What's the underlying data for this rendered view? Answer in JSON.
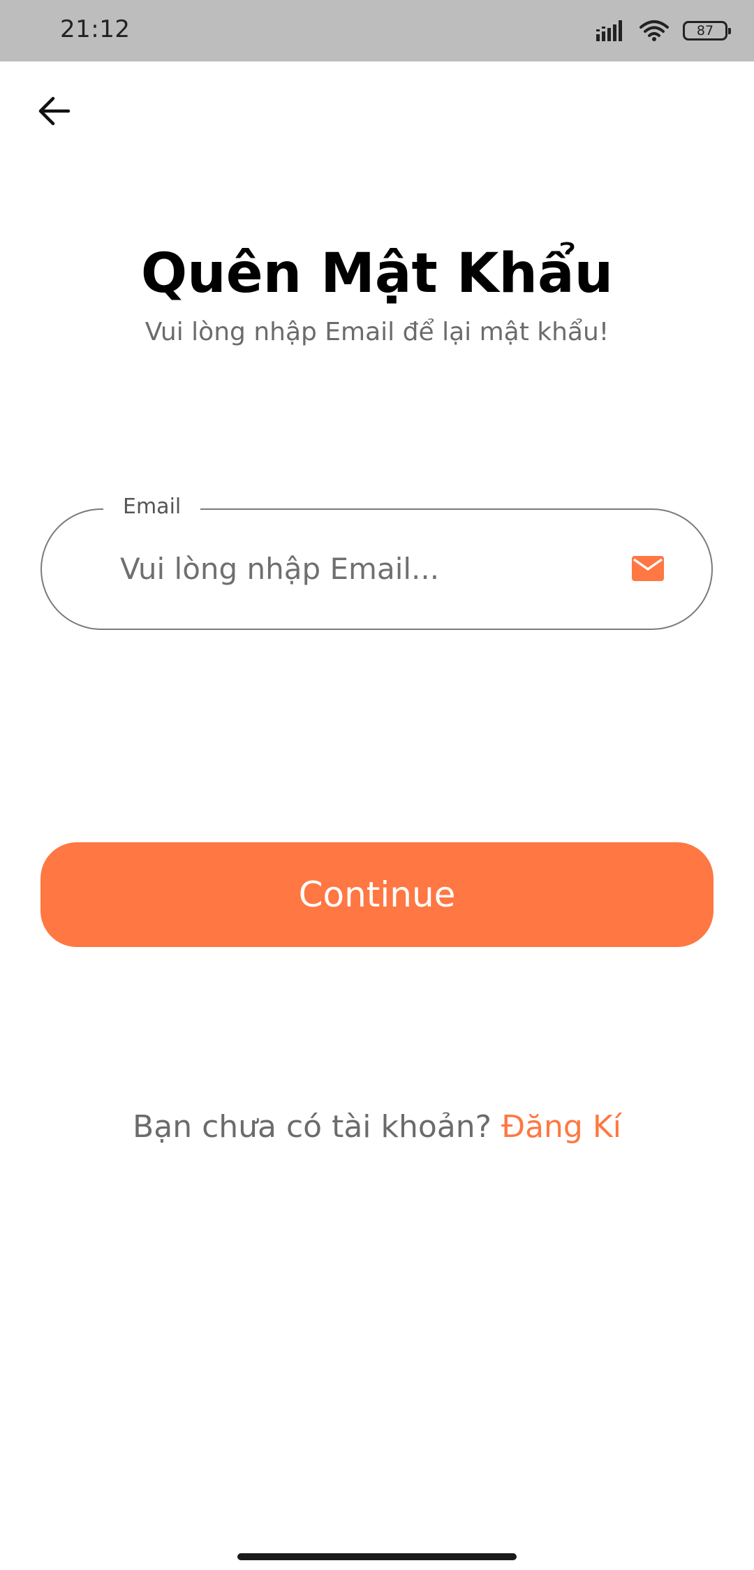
{
  "status_bar": {
    "time": "21:12",
    "battery_level": "87",
    "icons": [
      "signal-icon",
      "wifi-icon",
      "battery-icon"
    ]
  },
  "header": {
    "back_icon": "arrow-left-icon"
  },
  "page": {
    "title": "Quên Mật Khẩu",
    "subtitle": "Vui lòng nhập Email để lại mật khẩu!"
  },
  "email_field": {
    "label": "Email",
    "placeholder": "Vui lòng nhập Email...",
    "value": "",
    "icon": "mail-icon"
  },
  "continue_button": {
    "label": "Continue"
  },
  "register": {
    "prompt": "Bạn chưa có tài khoản? ",
    "link_label": "Đăng Kí"
  },
  "colors": {
    "accent": "#ff7742",
    "status_bar_bg": "#bdbdbd",
    "text_secondary": "#6b6b6b"
  }
}
